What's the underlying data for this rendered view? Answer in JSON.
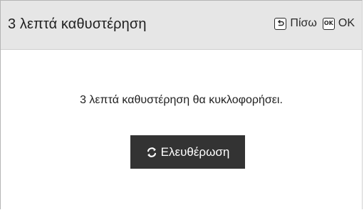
{
  "header": {
    "title": "3 λεπτά καθυστέρηση",
    "back_label": "Πίσω",
    "ok_key_glyph": "OK",
    "ok_label": "OK",
    "back_icon": "back-arrow-icon",
    "ok_icon": "ok-key-icon"
  },
  "main": {
    "message": "3 λεπτά καθυστέρηση θα κυκλοφορήσει.",
    "release_button_label": "Ελευθέρωση",
    "release_icon": "refresh-icon"
  },
  "colors": {
    "header_bg": "#e6e6e6",
    "button_bg": "#333333",
    "button_text": "#ffffff",
    "text": "#1f1f1f"
  }
}
